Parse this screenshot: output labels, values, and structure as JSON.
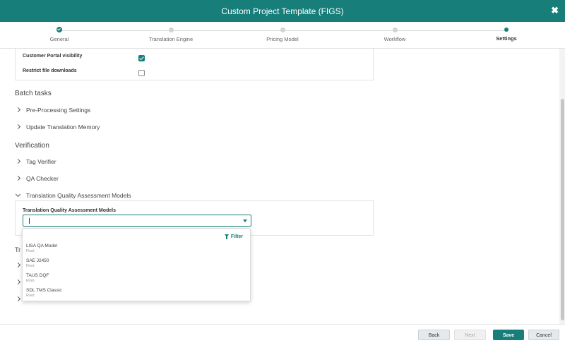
{
  "header": {
    "title": "Custom Project Template (FIGS)",
    "close_glyph": "✖"
  },
  "stepper": {
    "steps": [
      {
        "label": "General",
        "state": "done"
      },
      {
        "label": "Translation Engine",
        "state": "pending"
      },
      {
        "label": "Pricing Model",
        "state": "pending"
      },
      {
        "label": "Workflow",
        "state": "pending"
      },
      {
        "label": "Settings",
        "state": "active"
      }
    ]
  },
  "settings": {
    "customer_portal_label": "Customer Portal visibility",
    "customer_portal_checked": true,
    "restrict_downloads_label": "Restrict file downloads",
    "restrict_downloads_checked": false
  },
  "batch_tasks": {
    "title": "Batch tasks",
    "items": [
      "Pre-Processing Settings",
      "Update Translation Memory"
    ]
  },
  "verification": {
    "title": "Verification",
    "items": [
      "Tag Verifier",
      "QA Checker",
      "Translation Quality Assessment Models"
    ]
  },
  "tqa": {
    "field_label": "Translation Quality Assessment Models",
    "value": ""
  },
  "partial_text": {
    "section_prefix": "Tr"
  },
  "dropdown": {
    "filter_label": "Filter",
    "options": [
      {
        "name": "LISA QA Model",
        "sub": "Root"
      },
      {
        "name": "SAE J2450",
        "sub": "Root"
      },
      {
        "name": "TAUS DQF",
        "sub": "Root"
      },
      {
        "name": "SDL TMS Classic",
        "sub": "Root"
      }
    ]
  },
  "footer": {
    "back_label": "Back",
    "next_label": "Next",
    "save_label": "Save",
    "cancel_label": "Cancel"
  },
  "colors": {
    "brand": "#177e7a"
  }
}
